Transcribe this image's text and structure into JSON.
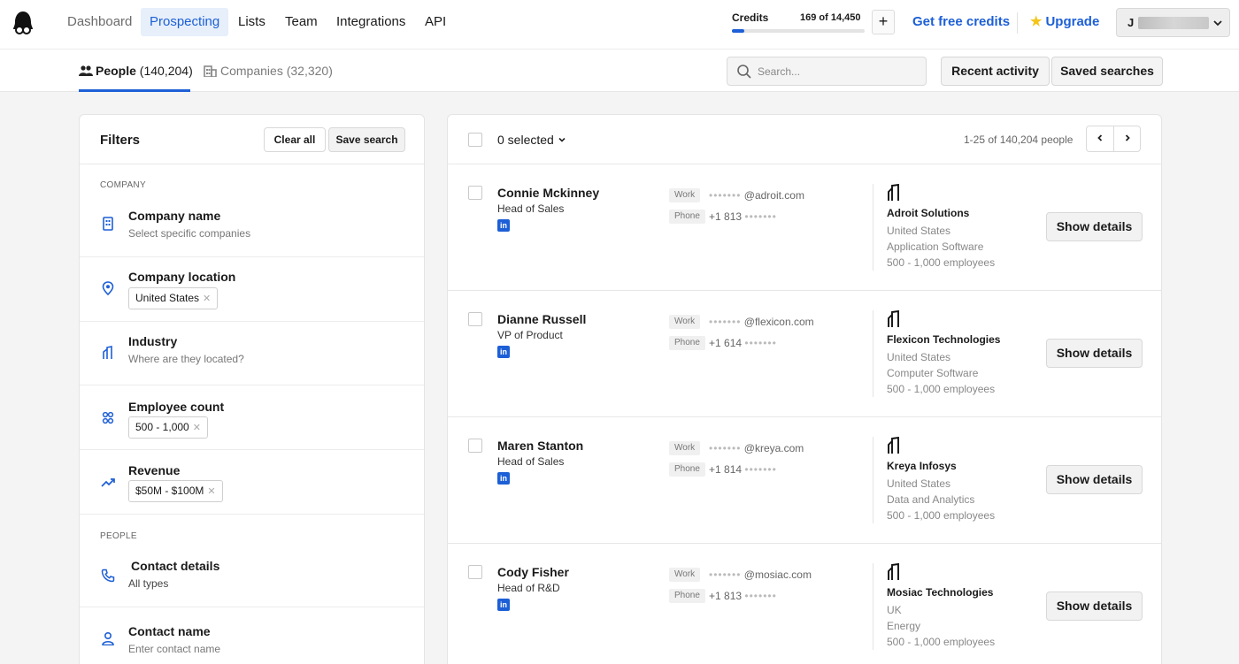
{
  "nav": {
    "items": [
      {
        "label": "Dashboard"
      },
      {
        "label": "Prospecting"
      },
      {
        "label": "Lists"
      },
      {
        "label": "Team"
      },
      {
        "label": "Integrations"
      },
      {
        "label": "API"
      }
    ],
    "active": "Prospecting",
    "credits_label": "Credits",
    "credits_value": "169 of 14,450",
    "credits_used_fraction": 0.0117,
    "plus_label": "+",
    "free_credits_label": "Get free credits",
    "upgrade_label": "Upgrade",
    "user_initial": "J",
    "accent_color": "#1d5fd6"
  },
  "subnav": {
    "people_label": "People",
    "people_count": "(140,204)",
    "companies_label": "Companies",
    "companies_count": "(32,320)",
    "search_placeholder": "Search...",
    "recent_activity_label": "Recent activity",
    "saved_searches_label": "Saved searches"
  },
  "filters": {
    "title": "Filters",
    "clear_all_label": "Clear all",
    "save_search_label": "Save search",
    "company_section_label": "COMPANY",
    "people_section_label": "PEOPLE",
    "company_name": {
      "title": "Company name",
      "subtitle": "Select specific companies"
    },
    "company_location": {
      "title": "Company location",
      "chip": "United States"
    },
    "industry": {
      "title": "Industry",
      "subtitle": "Where are they located?"
    },
    "employee_count": {
      "title": "Employee count",
      "chip": "500 - 1,000"
    },
    "revenue": {
      "title": "Revenue",
      "chip": "$50M - $100M"
    },
    "contact_details": {
      "title": "Contact details",
      "subtitle": "All types"
    },
    "contact_name": {
      "title": "Contact name",
      "subtitle": "Enter contact name"
    }
  },
  "results": {
    "selected_label": "0 selected",
    "range_label": "1-25 of 140,204 people",
    "work_label": "Work",
    "phone_label": "Phone",
    "masked": "•••••••",
    "show_details_label": "Show details",
    "linkedin_label": "in",
    "people": [
      {
        "name": "Connie Mckinney",
        "title": "Head of Sales",
        "email_domain": "@adroit.com",
        "phone_prefix": "+1 813",
        "company": "Adroit Solutions",
        "country": "United States",
        "industry": "Application Software",
        "employees": "500 - 1,000 employees"
      },
      {
        "name": "Dianne Russell",
        "title": "VP of Product",
        "email_domain": "@flexicon.com",
        "phone_prefix": "+1 614",
        "company": "Flexicon Technologies",
        "country": "United States",
        "industry": "Computer Software",
        "employees": "500 - 1,000 employees"
      },
      {
        "name": "Maren Stanton",
        "title": "Head of Sales",
        "email_domain": "@kreya.com",
        "phone_prefix": "+1 814",
        "company": "Kreya Infosys",
        "country": "United States",
        "industry": "Data and Analytics",
        "employees": "500 - 1,000 employees"
      },
      {
        "name": "Cody Fisher",
        "title": "Head of R&D",
        "email_domain": "@mosiac.com",
        "phone_prefix": "+1 813",
        "company": "Mosiac Technologies",
        "country": "UK",
        "industry": "Energy",
        "employees": "500 - 1,000 employees"
      }
    ]
  }
}
